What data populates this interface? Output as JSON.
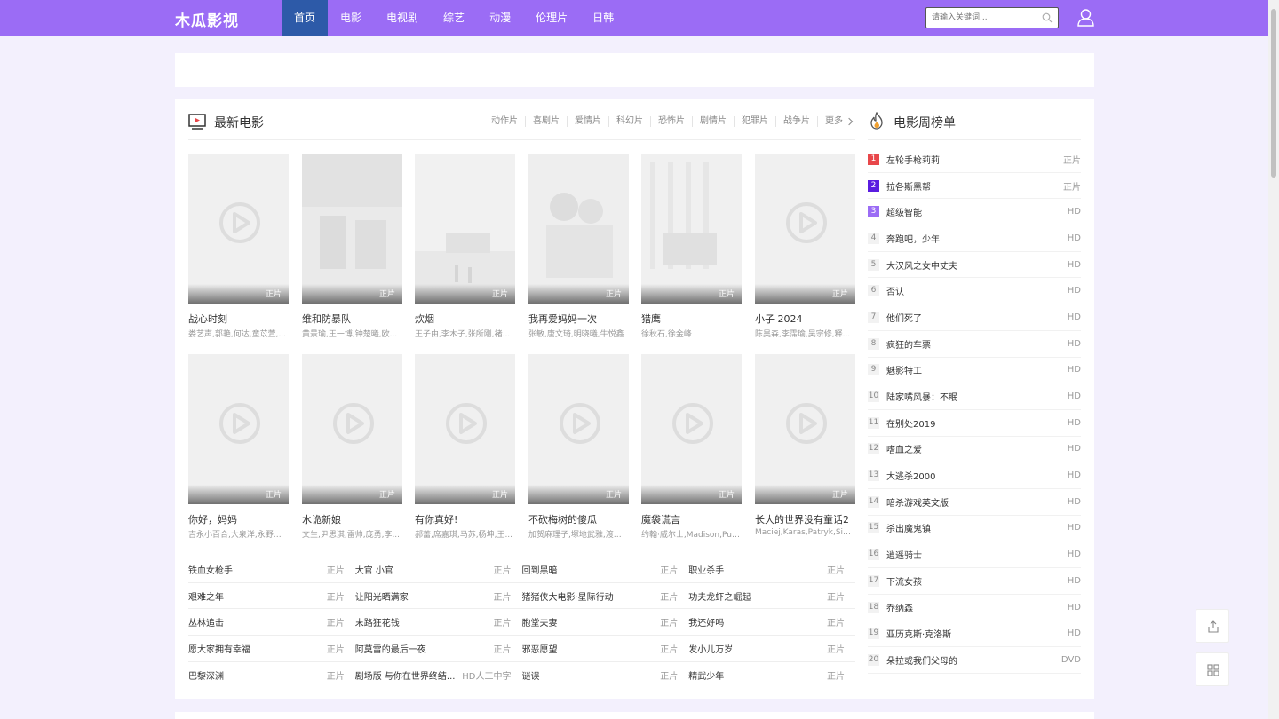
{
  "header": {
    "logo": "木瓜影视",
    "nav": [
      "首页",
      "电影",
      "电视剧",
      "综艺",
      "动漫",
      "伦理片",
      "日韩"
    ],
    "search_placeholder": "请输入关键词..."
  },
  "section": {
    "title": "最新电影",
    "categories": [
      "动作片",
      "喜剧片",
      "爱情片",
      "科幻片",
      "恐怖片",
      "剧情片",
      "犯罪片",
      "战争片",
      "更多"
    ]
  },
  "cards": [
    {
      "title": "战心时刻",
      "actors": "娄艺声,郭艳,何达,童苡萱,...",
      "badge": "正片"
    },
    {
      "title": "维和防暴队",
      "actors": "黄景瑜,王一博,钟楚曦,欧...",
      "badge": "正片"
    },
    {
      "title": "炊烟",
      "actors": "王子由,李木子,张所刚,褚...",
      "badge": "正片"
    },
    {
      "title": "我再爱妈妈一次",
      "actors": "张敏,唐文琦,明晓曦,牛悦鑫",
      "badge": "正片"
    },
    {
      "title": "猎鹰",
      "actors": "徐秋石,徐金峰",
      "badge": "正片"
    },
    {
      "title": "小子 2024",
      "actors": "陈昊森,李霈瑜,吴宗修,释...",
      "badge": "正片"
    },
    {
      "title": "你好，妈妈",
      "actors": "吉永小百合,大泉洋,永野芽...",
      "badge": "正片"
    },
    {
      "title": "水诡新娘",
      "actors": "文生,尹思淇,雷帅,庞勇,李...",
      "badge": "正片"
    },
    {
      "title": "有你真好!",
      "actors": "郝蕾,席嘉琪,马苏,杨坤,王...",
      "badge": "正片"
    },
    {
      "title": "不砍梅树的傻瓜",
      "actors": "加贺麻理子,塚地武雅,渡边...",
      "badge": "正片"
    },
    {
      "title": "魔袋谎言",
      "actors": "约翰·威尔士,Madison,Pull...",
      "badge": "正片"
    },
    {
      "title": "长大的世界没有童话2",
      "actors": "Maciej,Karas,Patryk,Sie...",
      "badge": "正片"
    }
  ],
  "text_list": [
    [
      {
        "t": "铁血女枪手",
        "s": "正片"
      },
      {
        "t": "大官 小官",
        "s": "正片"
      },
      {
        "t": "回到黑暗",
        "s": "正片"
      },
      {
        "t": "职业杀手",
        "s": "正片"
      }
    ],
    [
      {
        "t": "艰难之年",
        "s": "正片"
      },
      {
        "t": "让阳光晒满家",
        "s": "正片"
      },
      {
        "t": "猪猪侠大电影·星际行动",
        "s": "正片"
      },
      {
        "t": "功夫龙虾之崛起",
        "s": "正片"
      }
    ],
    [
      {
        "t": "丛林追击",
        "s": "正片"
      },
      {
        "t": "末路狂花钱",
        "s": "正片"
      },
      {
        "t": "胞堂夫妻",
        "s": "正片"
      },
      {
        "t": "我还好吗",
        "s": "正片"
      }
    ],
    [
      {
        "t": "愿大家拥有幸福",
        "s": "正片"
      },
      {
        "t": "阿莫雷的最后一夜",
        "s": "正片"
      },
      {
        "t": "邪恶愿望",
        "s": "正片"
      },
      {
        "t": "发小儿万岁",
        "s": "正片"
      }
    ],
    [
      {
        "t": "巴黎深渊",
        "s": "正片"
      },
      {
        "t": "剧场版 与你在世界终结...",
        "s": "HD人工中字"
      },
      {
        "t": "谜误",
        "s": "正片"
      },
      {
        "t": "精武少年",
        "s": "正片"
      }
    ]
  ],
  "ranking": {
    "title": "电影周榜单",
    "items": [
      {
        "n": "1",
        "name": "左轮手枪莉莉",
        "status": "正片"
      },
      {
        "n": "2",
        "name": "拉各斯黑帮",
        "status": "正片"
      },
      {
        "n": "3",
        "name": "超级智能",
        "status": "HD"
      },
      {
        "n": "4",
        "name": "奔跑吧，少年",
        "status": "HD"
      },
      {
        "n": "5",
        "name": "大汉风之女中丈夫",
        "status": "HD"
      },
      {
        "n": "6",
        "name": "否认",
        "status": "HD"
      },
      {
        "n": "7",
        "name": "他们死了",
        "status": "HD"
      },
      {
        "n": "8",
        "name": "疯狂的车票",
        "status": "HD"
      },
      {
        "n": "9",
        "name": "魅影特工",
        "status": "HD"
      },
      {
        "n": "10",
        "name": "陆家嘴风暴：不眠",
        "status": "HD"
      },
      {
        "n": "11",
        "name": "在别处2019",
        "status": "HD"
      },
      {
        "n": "12",
        "name": "嗜血之爱",
        "status": "HD"
      },
      {
        "n": "13",
        "name": "大逃杀2000",
        "status": "HD"
      },
      {
        "n": "14",
        "name": "暗杀游戏英文版",
        "status": "HD"
      },
      {
        "n": "15",
        "name": "杀出魔鬼镇",
        "status": "HD"
      },
      {
        "n": "16",
        "name": "逍遥骑士",
        "status": "HD"
      },
      {
        "n": "17",
        "name": "下流女孩",
        "status": "HD"
      },
      {
        "n": "18",
        "name": "乔纳森",
        "status": "HD"
      },
      {
        "n": "19",
        "name": "亚历克斯·克洛斯",
        "status": "HD"
      },
      {
        "n": "20",
        "name": "朵拉或我们父母的",
        "status": "DVD"
      }
    ]
  },
  "colors": {
    "header": "#9b6cf5",
    "nav_active": "#2d5aa8",
    "rank1": "#e8474a",
    "rank2": "#5a1ce0",
    "rank3": "#9b6cf5"
  },
  "icons": {
    "search": "search-icon",
    "user": "user-icon",
    "section": "tv-icon",
    "ranking": "fire-icon",
    "share": "share-icon",
    "qrcode": "qrcode-icon",
    "play": "play-icon"
  }
}
